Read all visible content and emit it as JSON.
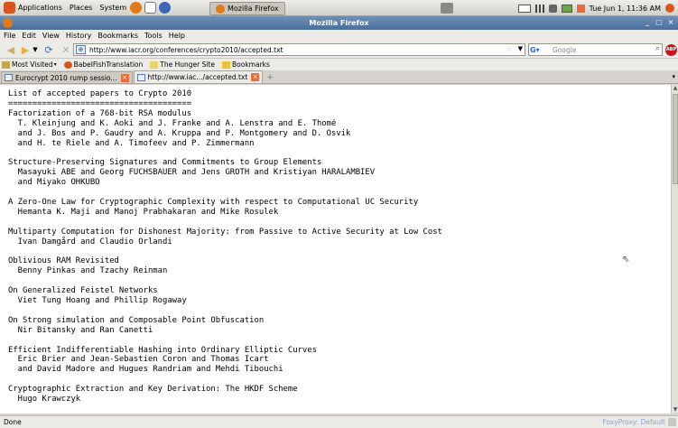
{
  "top_panel": {
    "menus": [
      "Applications",
      "Places",
      "System"
    ],
    "task_label": "Mozilla Firefox",
    "clock": "Tue Jun  1, 11:36 AM"
  },
  "window": {
    "title": "Mozilla Firefox"
  },
  "menubar": {
    "items": [
      "File",
      "Edit",
      "View",
      "History",
      "Bookmarks",
      "Tools",
      "Help"
    ]
  },
  "navbar": {
    "url": "http://www.iacr.org/conferences/crypto2010/accepted.txt",
    "search_placeholder": "Google",
    "abp_label": "ABP"
  },
  "bookmarks": {
    "items": [
      "Most Visited",
      "BabelFishTranslation",
      "The Hunger Site",
      "Bookmarks"
    ]
  },
  "tabs": {
    "items": [
      {
        "label": "Eurocrypt 2010 rump sessio..."
      },
      {
        "label": "http://www.iac.../accepted.txt"
      }
    ]
  },
  "document": {
    "lines": [
      "List of accepted papers to Crypto 2010",
      "======================================",
      "Factorization of a 768-bit RSA modulus",
      "  T. Kleinjung and K. Aoki and J. Franke and A. Lenstra and E. Thomé",
      "  and J. Bos and P. Gaudry and A. Kruppa and P. Montgomery and D. Osvik",
      "  and H. te Riele and A. Timofeev and P. Zimmermann",
      "",
      "Structure-Preserving Signatures and Commitments to Group Elements",
      "  Masayuki ABE and Georg FUCHSBAUER and Jens GROTH and Kristiyan HARALAMBIEV",
      "  and Miyako OHKUBO",
      "",
      "A Zero-One Law for Cryptographic Complexity with respect to Computational UC Security",
      "  Hemanta K. Maji and Manoj Prabhakaran and Mike Rosulek",
      "",
      "Multiparty Computation for Dishonest Majority: from Passive to Active Security at Low Cost",
      "  Ivan Damgård and Claudio Orlandi",
      "",
      "Oblivious RAM Revisited",
      "  Benny Pinkas and Tzachy Reinman",
      "",
      "On Generalized Feistel Networks",
      "  Viet Tung Hoang and Phillip Rogaway",
      "",
      "On Strong simulation and Composable Point Obfuscation",
      "  Nir Bitansky and Ran Canetti",
      "",
      "Efficient Indifferentiable Hashing into Ordinary Elliptic Curves",
      "  Eric Brier and Jean-Sebastien Coron and Thomas Icart",
      "  and David Madore and Hugues Randriam and Mehdi Tibouchi",
      "",
      "Cryptographic Extraction and Key Derivation: The HKDF Scheme",
      "  Hugo Krawczyk"
    ]
  },
  "statusbar": {
    "status": "Done",
    "proxy": "FoxyProxy: Default"
  }
}
